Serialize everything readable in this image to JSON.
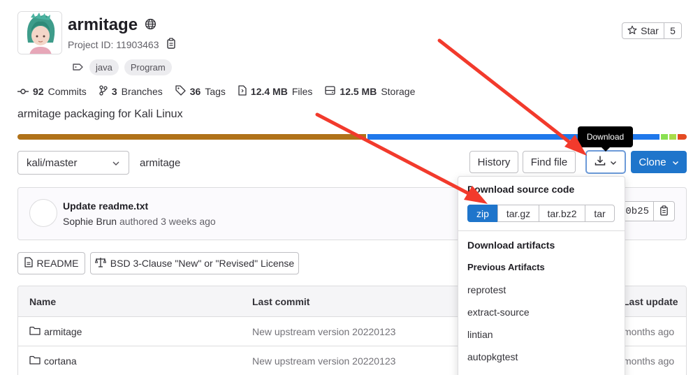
{
  "project": {
    "name": "armitage",
    "id_label": "Project ID: 11903463",
    "topics": [
      "java",
      "Program"
    ],
    "description": "armitage packaging for Kali Linux"
  },
  "star": {
    "label": "Star",
    "count": "5"
  },
  "stats": [
    {
      "icon": "commit-icon",
      "value": "92",
      "label": "Commits"
    },
    {
      "icon": "branch-icon",
      "value": "3",
      "label": "Branches"
    },
    {
      "icon": "tag-icon",
      "value": "36",
      "label": "Tags"
    },
    {
      "icon": "file-icon",
      "value": "12.4 MB",
      "label": "Files"
    },
    {
      "icon": "storage-icon",
      "value": "12.5 MB",
      "label": "Storage"
    }
  ],
  "language_bar": {
    "segments": [
      {
        "color": "#b07219",
        "fraction": 0.525
      },
      {
        "color": "#1f78eb",
        "fraction": 0.44
      },
      {
        "color": "#89e051",
        "fraction": 0.011
      },
      {
        "color": "#a9dc4a",
        "fraction": 0.01
      },
      {
        "color": "#e44b23",
        "fraction": 0.014
      }
    ]
  },
  "toolbar": {
    "branch": "kali/master",
    "breadcrumb": "armitage",
    "history": "History",
    "find_file": "Find file",
    "download_tooltip": "Download",
    "clone": "Clone"
  },
  "commit": {
    "title": "Update readme.txt",
    "author": "Sophie Brun",
    "meta": "authored 3 weeks ago",
    "sha": "0b25"
  },
  "badges": {
    "readme": "README",
    "license": "BSD 3-Clause \"New\" or \"Revised\" License"
  },
  "table": {
    "headers": [
      "Name",
      "Last commit",
      "Last update"
    ],
    "rows": [
      {
        "name": "armitage",
        "commit": "New upstream version 20220123",
        "update": "months ago"
      },
      {
        "name": "cortana",
        "commit": "New upstream version 20220123",
        "update": "months ago"
      }
    ]
  },
  "download_menu": {
    "source_header": "Download source code",
    "formats": [
      "zip",
      "tar.gz",
      "tar.bz2",
      "tar"
    ],
    "artifacts_header": "Download artifacts",
    "previous_header": "Previous Artifacts",
    "artifacts": [
      "reprotest",
      "extract-source",
      "lintian",
      "autopkgtest"
    ]
  },
  "annotations": {
    "arrow_color": "#f23a2c"
  }
}
